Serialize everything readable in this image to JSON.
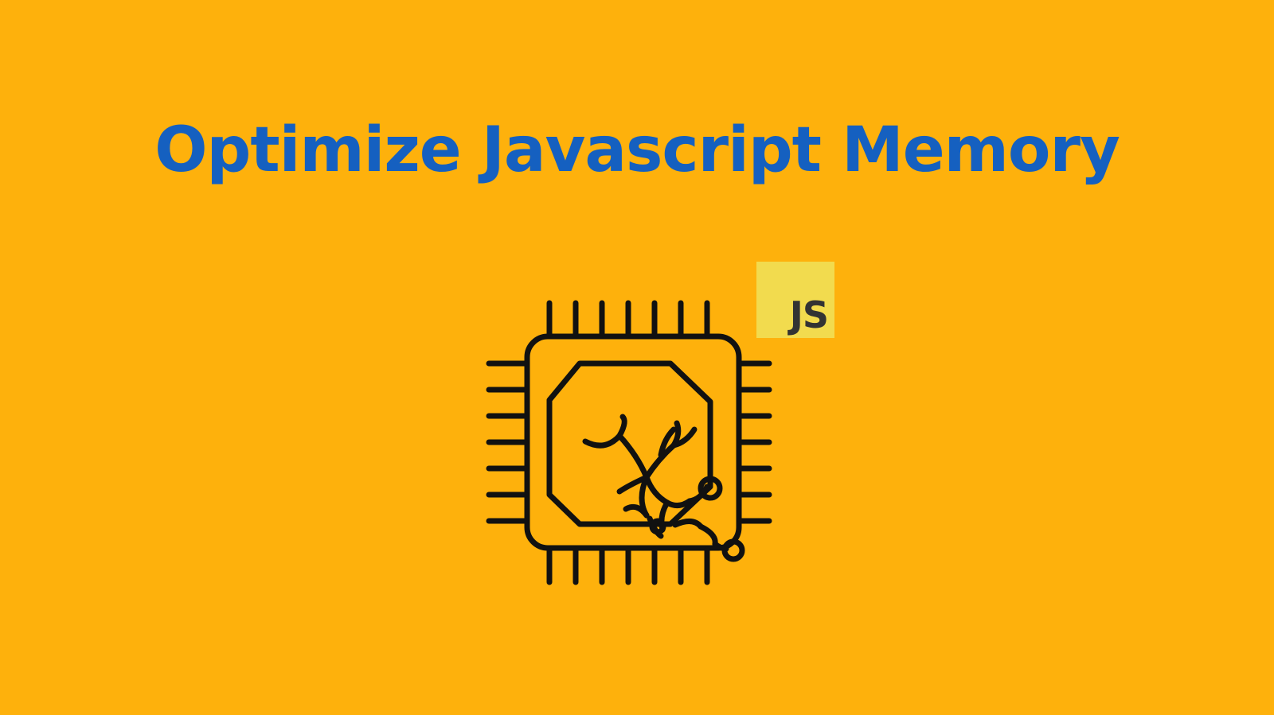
{
  "title": "Optimize Javascript Memory",
  "badge": {
    "label": "JS"
  },
  "icons": {
    "main": "cpu-chip-with-broken-tree-icon",
    "badge": "javascript-logo-icon"
  },
  "colors": {
    "background": "#FEB10C",
    "title": "#1560C0",
    "stroke": "#111111",
    "badge_bg": "#F2DB4E",
    "badge_text": "#333333"
  }
}
